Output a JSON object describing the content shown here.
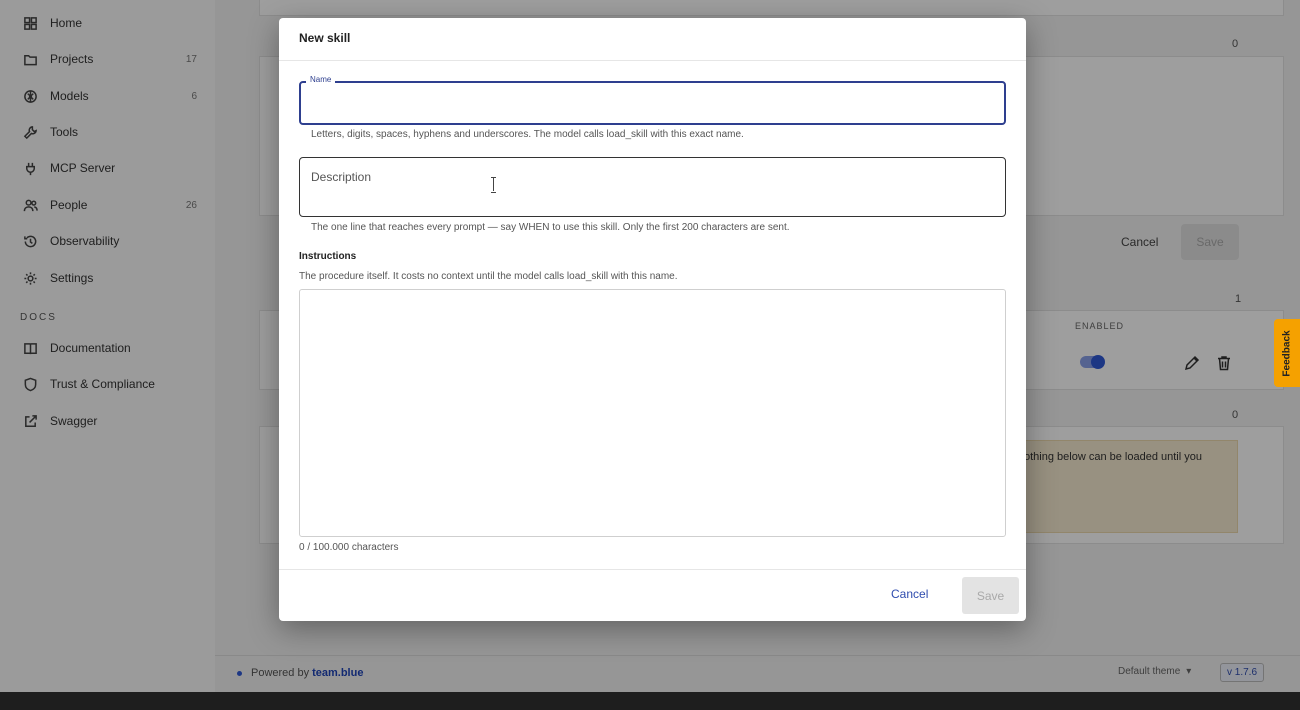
{
  "sidebar": {
    "items": [
      {
        "label": "Home",
        "icon": "grid-icon",
        "count": ""
      },
      {
        "label": "Projects",
        "icon": "folder-icon",
        "count": "17"
      },
      {
        "label": "Models",
        "icon": "model-icon",
        "count": "6"
      },
      {
        "label": "Tools",
        "icon": "wrench-icon",
        "count": ""
      },
      {
        "label": "MCP Server",
        "icon": "plug-icon",
        "count": ""
      },
      {
        "label": "People",
        "icon": "people-icon",
        "count": "26"
      },
      {
        "label": "Observability",
        "icon": "history-icon",
        "count": ""
      },
      {
        "label": "Settings",
        "icon": "gear-icon",
        "count": ""
      }
    ],
    "docs_label": "DOCS",
    "docs_items": [
      {
        "label": "Documentation",
        "icon": "book-icon"
      },
      {
        "label": "Trust & Compliance",
        "icon": "shield-icon"
      },
      {
        "label": "Swagger",
        "icon": "external-link-icon"
      }
    ]
  },
  "background": {
    "cancel": "Cancel",
    "save": "Save",
    "enabled_header": "ENABLED",
    "warning_text": "othing below can be loaded until you",
    "count_0a": "0",
    "count_1": "1",
    "count_0b": "0",
    "feedback": "Feedback"
  },
  "footer": {
    "powered_by": "Powered by",
    "brand": "team.blue",
    "theme": "Default theme",
    "version": "v 1.7.6"
  },
  "modal": {
    "title": "New skill",
    "name_label": "Name",
    "name_value": "",
    "name_helper": "Letters, digits, spaces, hyphens and underscores. The model calls load_skill with this exact name.",
    "description_placeholder": "Description",
    "description_helper": "The one line that reaches every prompt — say WHEN to use this skill. Only the first 200 characters are sent.",
    "instructions_label": "Instructions",
    "instructions_helper": "The procedure itself. It costs no context until the model calls load_skill with this name.",
    "instructions_value": "",
    "char_count": "0 / 100.000 characters",
    "cancel": "Cancel",
    "save": "Save"
  },
  "colors": {
    "accent": "#2e3f8f",
    "link": "#2f4cae",
    "feedback": "#f5a100"
  }
}
